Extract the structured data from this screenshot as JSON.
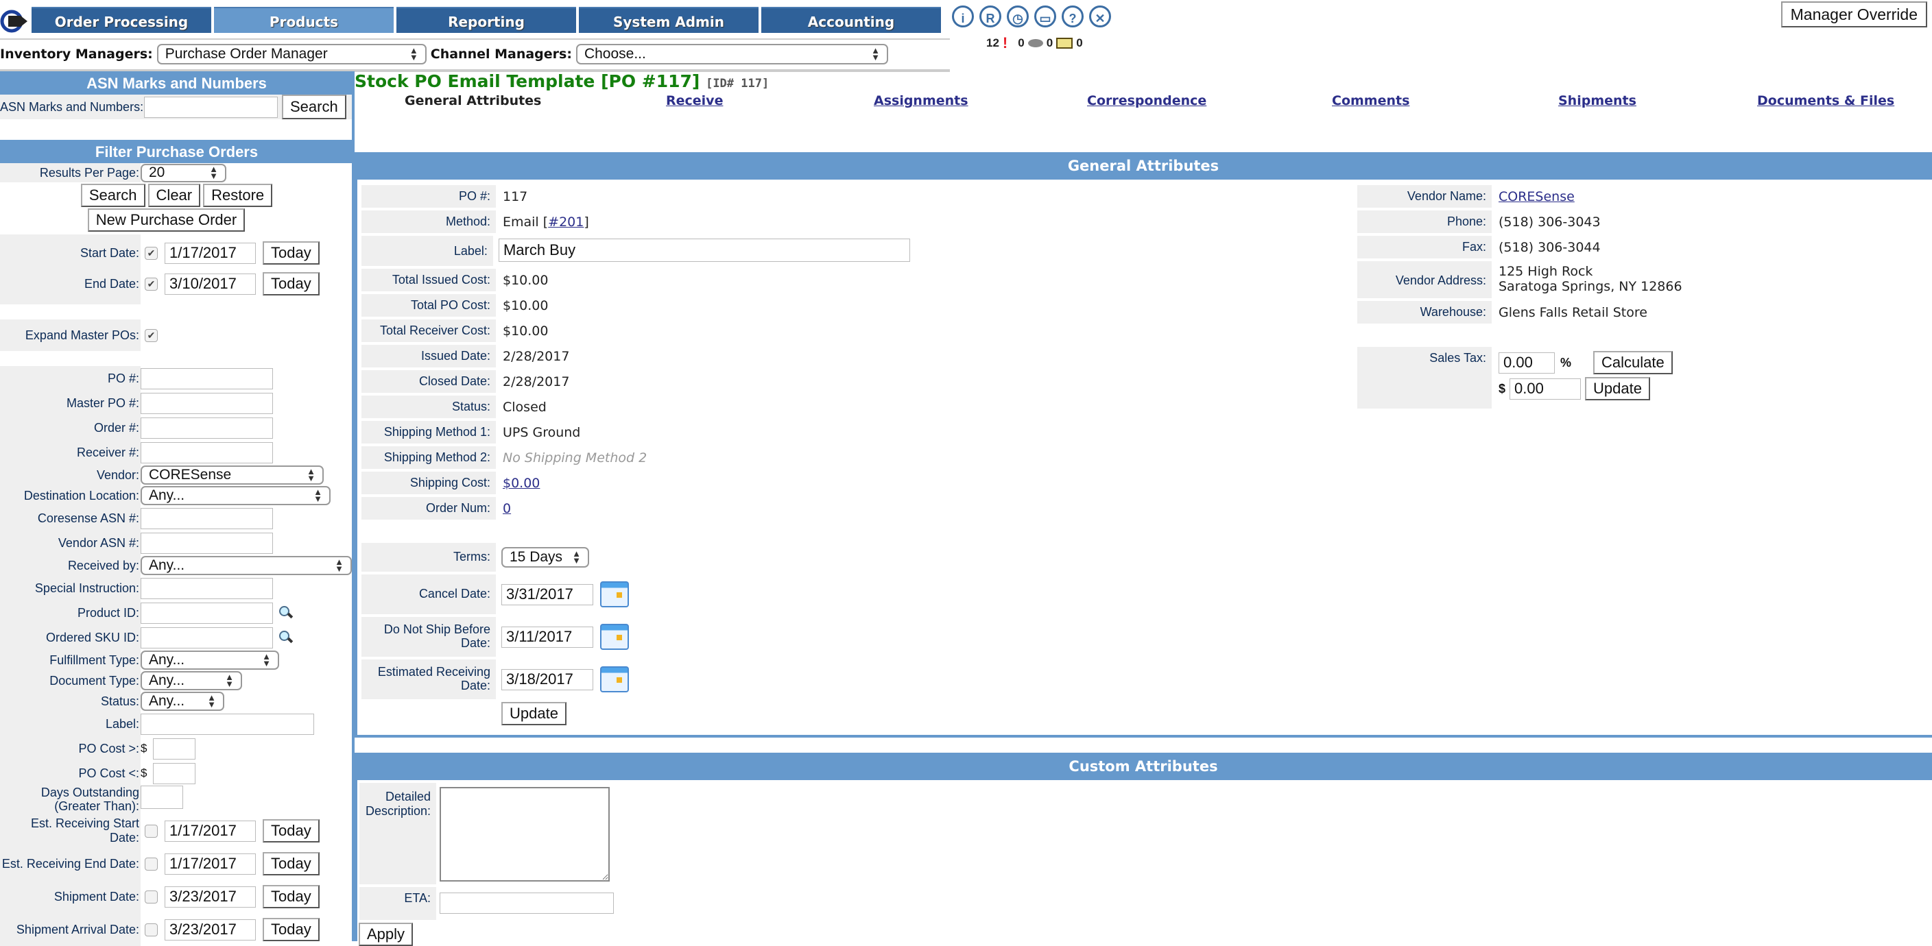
{
  "nav": {
    "tabs": [
      {
        "label": "Order Processing",
        "active": false
      },
      {
        "label": "Products",
        "active": true
      },
      {
        "label": "Reporting",
        "active": false
      },
      {
        "label": "System Admin",
        "active": false
      },
      {
        "label": "Accounting",
        "active": false
      }
    ],
    "tool_icons": [
      "info-icon",
      "r-icon",
      "clock-icon",
      "monitor-icon",
      "help-icon",
      "close-icon"
    ],
    "tool_glyphs": [
      "i",
      "R",
      "◷",
      "▭",
      "?",
      "✕"
    ],
    "counters": {
      "alerts": "12",
      "messages": "0",
      "mail": "0",
      "mail_after": "0"
    },
    "manager_override": "Manager Override"
  },
  "managers": {
    "inventory_label": "Inventory Managers:",
    "inventory_value": "Purchase Order Manager",
    "channel_label": "Channel Managers:",
    "channel_value": "Choose..."
  },
  "sidebar": {
    "asn": {
      "heading": "ASN Marks and Numbers",
      "label": "ASN Marks and Numbers:",
      "value": "",
      "search_button": "Search"
    },
    "filter": {
      "heading": "Filter Purchase Orders",
      "results_per_page_label": "Results Per Page:",
      "results_per_page_value": "20",
      "search_button": "Search",
      "clear_button": "Clear",
      "restore_button": "Restore",
      "new_po_button": "New Purchase Order",
      "start_date": {
        "label": "Start Date:",
        "checked": true,
        "value": "1/17/2017",
        "today": "Today"
      },
      "end_date": {
        "label": "End Date:",
        "checked": true,
        "value": "3/10/2017",
        "today": "Today"
      },
      "expand_master": {
        "label": "Expand Master POs:",
        "checked": true
      },
      "text_fields": [
        {
          "label": "PO #:",
          "value": ""
        },
        {
          "label": "Master PO #:",
          "value": ""
        },
        {
          "label": "Order #:",
          "value": ""
        },
        {
          "label": "Receiver #:",
          "value": ""
        }
      ],
      "vendor": {
        "label": "Vendor:",
        "value": "CORESense"
      },
      "destination": {
        "label": "Destination Location:",
        "value": "Any..."
      },
      "coresense_asn": {
        "label": "Coresense ASN #:",
        "value": ""
      },
      "vendor_asn": {
        "label": "Vendor ASN #:",
        "value": ""
      },
      "received_by": {
        "label": "Received by:",
        "value": "Any..."
      },
      "special_instruction": {
        "label": "Special Instruction:",
        "value": ""
      },
      "product_id": {
        "label": "Product ID:",
        "value": ""
      },
      "ordered_sku": {
        "label": "Ordered SKU ID:",
        "value": ""
      },
      "fulfillment_type": {
        "label": "Fulfillment Type:",
        "value": "Any..."
      },
      "document_type": {
        "label": "Document Type:",
        "value": "Any..."
      },
      "status": {
        "label": "Status:",
        "value": "Any..."
      },
      "label": {
        "label": "Label:",
        "value": ""
      },
      "po_cost_gt": {
        "label": "PO Cost >:",
        "currency": "$",
        "value": ""
      },
      "po_cost_lt": {
        "label": "PO Cost <:",
        "currency": "$",
        "value": ""
      },
      "days_outstanding": {
        "label1": "Days Outstanding",
        "label2": "(Greater Than):",
        "value": ""
      },
      "date_filters": [
        {
          "label": "Est. Receiving Start Date:",
          "checked": false,
          "value": "1/17/2017",
          "today": "Today"
        },
        {
          "label": "Est. Receiving End Date:",
          "checked": false,
          "value": "1/17/2017",
          "today": "Today"
        },
        {
          "label": "Shipment Date:",
          "checked": false,
          "value": "3/23/2017",
          "today": "Today"
        },
        {
          "label": "Shipment Arrival Date:",
          "checked": false,
          "value": "3/23/2017",
          "today": "Today"
        }
      ]
    }
  },
  "main": {
    "title": "Stock PO Email Template [PO #117]",
    "id_tag": "[ID# 117]",
    "subtabs": [
      {
        "label": "General Attributes",
        "current": true
      },
      {
        "label": "Receive",
        "current": false
      },
      {
        "label": "Assignments",
        "current": false
      },
      {
        "label": "Correspondence",
        "current": false
      },
      {
        "label": "Comments",
        "current": false
      },
      {
        "label": "Shipments",
        "current": false
      },
      {
        "label": "Documents & Files",
        "current": false
      }
    ],
    "general": {
      "heading": "General Attributes",
      "po_num": {
        "label": "PO #:",
        "value": "117"
      },
      "method": {
        "label": "Method:",
        "value": "Email",
        "link": "#201"
      },
      "label": {
        "label": "Label:",
        "value": "March Buy"
      },
      "fields": [
        {
          "label": "Total Issued Cost:",
          "value": "$10.00"
        },
        {
          "label": "Total PO Cost:",
          "value": "$10.00"
        },
        {
          "label": "Total Receiver Cost:",
          "value": "$10.00"
        },
        {
          "label": "Issued Date:",
          "value": "2/28/2017"
        },
        {
          "label": "Closed Date:",
          "value": "2/28/2017"
        },
        {
          "label": "Status:",
          "value": "Closed"
        },
        {
          "label": "Shipping Method 1:",
          "value": "UPS Ground"
        }
      ],
      "shipping_method_2": {
        "label": "Shipping Method 2:",
        "value": "No Shipping Method 2"
      },
      "shipping_cost": {
        "label": "Shipping Cost:",
        "value": "$0.00"
      },
      "order_num": {
        "label": "Order Num:",
        "value": "0"
      },
      "terms": {
        "label": "Terms:",
        "value": "15 Days"
      },
      "date_fields": [
        {
          "label": "Cancel Date:",
          "value": "3/31/2017"
        },
        {
          "label": "Do Not Ship Before Date:",
          "value": "3/11/2017"
        },
        {
          "label": "Estimated Receiving Date:",
          "value": "3/18/2017"
        }
      ],
      "update_button": "Update",
      "vendor": {
        "name_label": "Vendor Name:",
        "name": "CORESense",
        "phone_label": "Phone:",
        "phone": "(518) 306-3043",
        "fax_label": "Fax:",
        "fax": "(518) 306-3044",
        "address_label": "Vendor Address:",
        "address_line1": "125 High Rock",
        "address_line2": "Saratoga Springs, NY 12866",
        "warehouse_label": "Warehouse:",
        "warehouse": "Glens Falls Retail Store"
      },
      "sales_tax": {
        "label": "Sales Tax:",
        "percent_value": "0.00",
        "percent_sign": "%",
        "calculate_button": "Calculate",
        "currency": "$",
        "amount_value": "0.00",
        "update_button": "Update"
      }
    },
    "custom": {
      "heading": "Custom Attributes",
      "description_label": "Detailed Description:",
      "description_value": "",
      "eta_label": "ETA:",
      "eta_value": "",
      "apply_button": "Apply"
    }
  }
}
